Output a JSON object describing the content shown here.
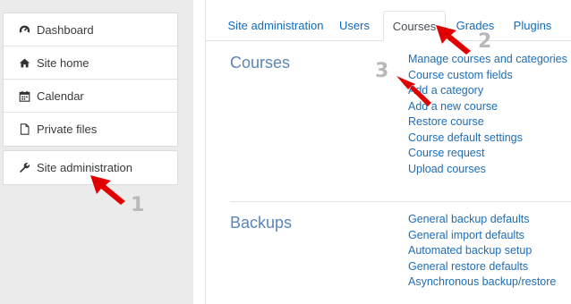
{
  "sidebar": {
    "items": [
      {
        "label": "Dashboard",
        "icon": "dashboard-icon"
      },
      {
        "label": "Site home",
        "icon": "home-icon"
      },
      {
        "label": "Calendar",
        "icon": "calendar-icon"
      },
      {
        "label": "Private files",
        "icon": "file-icon"
      }
    ],
    "admin": {
      "label": "Site administration",
      "icon": "wrench-icon"
    }
  },
  "tabs": [
    {
      "label": "Site administration",
      "active": false
    },
    {
      "label": "Users",
      "active": false
    },
    {
      "label": "Courses",
      "active": true
    },
    {
      "label": "Grades",
      "active": false
    },
    {
      "label": "Plugins",
      "active": false
    }
  ],
  "sections": [
    {
      "title": "Courses",
      "links": [
        "Manage courses and categories",
        "Course custom fields",
        "Add a category",
        "Add a new course",
        "Restore course",
        "Course default settings",
        "Course request",
        "Upload courses"
      ]
    },
    {
      "title": "Backups",
      "links": [
        "General backup defaults",
        "General import defaults",
        "Automated backup setup",
        "General restore defaults",
        "Asynchronous backup/restore"
      ]
    }
  ],
  "annotations": {
    "step1": "1",
    "step2": "2",
    "step3": "3",
    "arrow_color": "#e00000"
  },
  "colors": {
    "link": "#1f6db6",
    "section_title": "#5a86b8",
    "sidebar_bg": "#ebebeb"
  }
}
